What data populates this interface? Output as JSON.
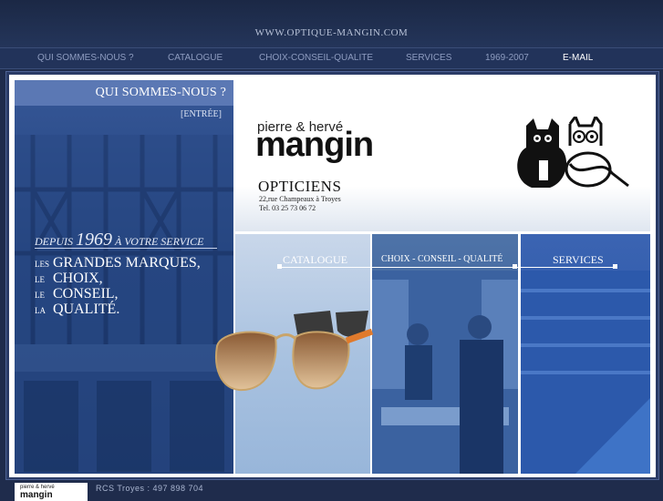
{
  "site_url": "WWW.OPTIQUE-MANGIN.COM",
  "nav": {
    "items": [
      {
        "label": "QUI SOMMES-NOUS ?"
      },
      {
        "label": "CATALOGUE"
      },
      {
        "label": "CHOIX-CONSEIL-QUALITE"
      },
      {
        "label": "SERVICES"
      },
      {
        "label": "1969-2007"
      },
      {
        "label": "E-MAIL"
      }
    ],
    "active_label": "E-MAIL"
  },
  "left_panel": {
    "title": "QUI SOMMES-NOUS ?",
    "enter_link": "[ENTRÉE]",
    "since_prefix": "DEPUIS",
    "since_year": "1969",
    "since_suffix": "À VOTRE SERVICE",
    "values": [
      {
        "article": "LES",
        "word": "GRANDES MARQUES,"
      },
      {
        "article": "LE",
        "word": "CHOIX,"
      },
      {
        "article": "LE",
        "word": "CONSEIL,"
      },
      {
        "article": "LA",
        "word": "QUALITÉ."
      }
    ]
  },
  "header": {
    "brand_small": "pierre & hervé",
    "brand_big": "mangin",
    "subtitle": "OPTICIENS",
    "address_line1": "22,rue Champeaux à Troyes",
    "address_line2": "Tel. 03 25 73 06 72"
  },
  "panels": {
    "catalogue": "CATALOGUE",
    "choix": "CHOIX - CONSEIL - QUALITÉ",
    "services": "SERVICES"
  },
  "footer": {
    "logo_small": "pierre & hervé",
    "logo_big": "mangin",
    "rcs": "RCS Troyes : 497 898 704"
  },
  "colors": {
    "background": "#1f2c4c",
    "nav_text": "#8e9cc0",
    "accent_blue": "#365797"
  }
}
